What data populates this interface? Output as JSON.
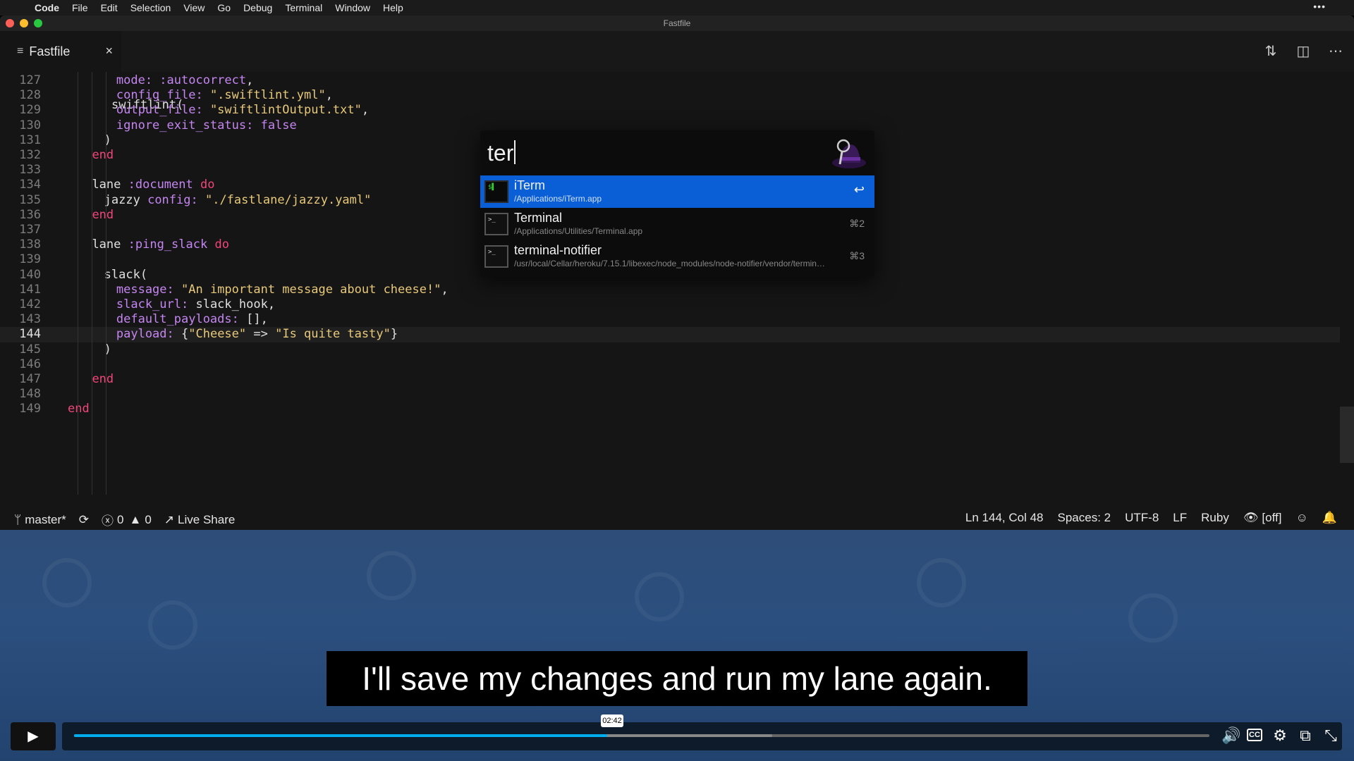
{
  "menubar": {
    "app": "Code",
    "items": [
      "File",
      "Edit",
      "Selection",
      "View",
      "Go",
      "Debug",
      "Terminal",
      "Window",
      "Help"
    ],
    "right": "•••"
  },
  "window": {
    "title": "Fastfile"
  },
  "tab": {
    "label": "Fastfile",
    "close": "×"
  },
  "tab_actions": [
    "compare-icon",
    "split-editor-icon",
    "more-icon"
  ],
  "editor": {
    "lines": [
      {
        "n": "127",
        "segments": [
          {
            "t": "mode: ",
            "c": "sym"
          },
          {
            "t": ":autocorrect",
            "c": "sym"
          },
          {
            "t": ",",
            "c": "pl"
          }
        ],
        "indent": 4
      },
      {
        "n": "128",
        "segments": [
          {
            "t": "config_file: ",
            "c": "sym"
          },
          {
            "t": "\".swiftlint.yml\"",
            "c": "str"
          },
          {
            "t": ",",
            "c": "pl"
          }
        ],
        "indent": 4
      },
      {
        "n": "129",
        "segments": [
          {
            "t": "output_file: ",
            "c": "sym"
          },
          {
            "t": "\"swiftlintOutput.txt\"",
            "c": "str"
          },
          {
            "t": ",",
            "c": "pl"
          }
        ],
        "indent": 4
      },
      {
        "n": "130",
        "segments": [
          {
            "t": "ignore_exit_status: ",
            "c": "sym"
          },
          {
            "t": "false",
            "c": "sym"
          }
        ],
        "indent": 4
      },
      {
        "n": "131",
        "segments": [
          {
            "t": ")",
            "c": "pl"
          }
        ],
        "indent": 3
      },
      {
        "n": "132",
        "segments": [
          {
            "t": "end",
            "c": "kw"
          }
        ],
        "indent": 2
      },
      {
        "n": "133",
        "segments": [],
        "indent": 0
      },
      {
        "n": "134",
        "segments": [
          {
            "t": "lane ",
            "c": "pl"
          },
          {
            "t": ":document",
            "c": "sym"
          },
          {
            "t": " do",
            "c": "kw"
          }
        ],
        "indent": 2
      },
      {
        "n": "135",
        "segments": [
          {
            "t": "jazzy ",
            "c": "pl"
          },
          {
            "t": "config: ",
            "c": "sym"
          },
          {
            "t": "\"./fastlane/jazzy.yaml\"",
            "c": "str"
          }
        ],
        "indent": 3
      },
      {
        "n": "136",
        "segments": [
          {
            "t": "end",
            "c": "kw"
          }
        ],
        "indent": 2
      },
      {
        "n": "137",
        "segments": [],
        "indent": 0
      },
      {
        "n": "138",
        "segments": [
          {
            "t": "lane ",
            "c": "pl"
          },
          {
            "t": ":ping_slack",
            "c": "sym"
          },
          {
            "t": " do",
            "c": "kw"
          }
        ],
        "indent": 2
      },
      {
        "n": "139",
        "segments": [],
        "indent": 0
      },
      {
        "n": "140",
        "segments": [
          {
            "t": "slack(",
            "c": "pl"
          }
        ],
        "indent": 3
      },
      {
        "n": "141",
        "segments": [
          {
            "t": "message: ",
            "c": "sym"
          },
          {
            "t": "\"An important message about cheese!\"",
            "c": "str"
          },
          {
            "t": ",",
            "c": "pl"
          }
        ],
        "indent": 4
      },
      {
        "n": "142",
        "segments": [
          {
            "t": "slack_url: ",
            "c": "sym"
          },
          {
            "t": "slack_hook,",
            "c": "pl"
          }
        ],
        "indent": 4
      },
      {
        "n": "143",
        "segments": [
          {
            "t": "default_payloads: ",
            "c": "sym"
          },
          {
            "t": "[],",
            "c": "pl"
          }
        ],
        "indent": 4
      },
      {
        "n": "144",
        "segments": [
          {
            "t": "payload: ",
            "c": "sym"
          },
          {
            "t": "{",
            "c": "pl"
          },
          {
            "t": "\"Cheese\"",
            "c": "str"
          },
          {
            "t": " => ",
            "c": "pl"
          },
          {
            "t": "\"Is quite tasty\"",
            "c": "str"
          },
          {
            "t": "}",
            "c": "pl"
          }
        ],
        "indent": 4,
        "current": true
      },
      {
        "n": "145",
        "segments": [
          {
            "t": ")",
            "c": "pl"
          }
        ],
        "indent": 3
      },
      {
        "n": "146",
        "segments": [],
        "indent": 0
      },
      {
        "n": "147",
        "segments": [
          {
            "t": "end",
            "c": "kw"
          }
        ],
        "indent": 2
      },
      {
        "n": "148",
        "segments": [],
        "indent": 0
      },
      {
        "n": "149",
        "segments": [
          {
            "t": "end",
            "c": "kw"
          }
        ],
        "indent": 0
      }
    ]
  },
  "statusbar": {
    "branch": "master*",
    "errors": "0",
    "warnings": "0",
    "live_share": "Live Share",
    "position": "Ln 144, Col 48",
    "spaces": "Spaces: 2",
    "encoding": "UTF-8",
    "eol": "LF",
    "language": "Ruby",
    "watch": "[off]"
  },
  "launcher": {
    "query": "ter",
    "results": [
      {
        "title": "iTerm",
        "subtitle": "/Applications/iTerm.app",
        "key": "↩",
        "selected": true
      },
      {
        "title": "Terminal",
        "subtitle": "/Applications/Utilities/Terminal.app",
        "key": "⌘2",
        "selected": false
      },
      {
        "title": "terminal-notifier",
        "subtitle": "/usr/local/Cellar/heroku/7.15.1/libexec/node_modules/node-notifier/vendor/termin…",
        "key": "⌘3",
        "selected": false
      }
    ]
  },
  "video": {
    "caption": "I'll save my changes and run my lane again.",
    "time": "02:42",
    "progress": 0.4697,
    "accent": "#00adef"
  }
}
